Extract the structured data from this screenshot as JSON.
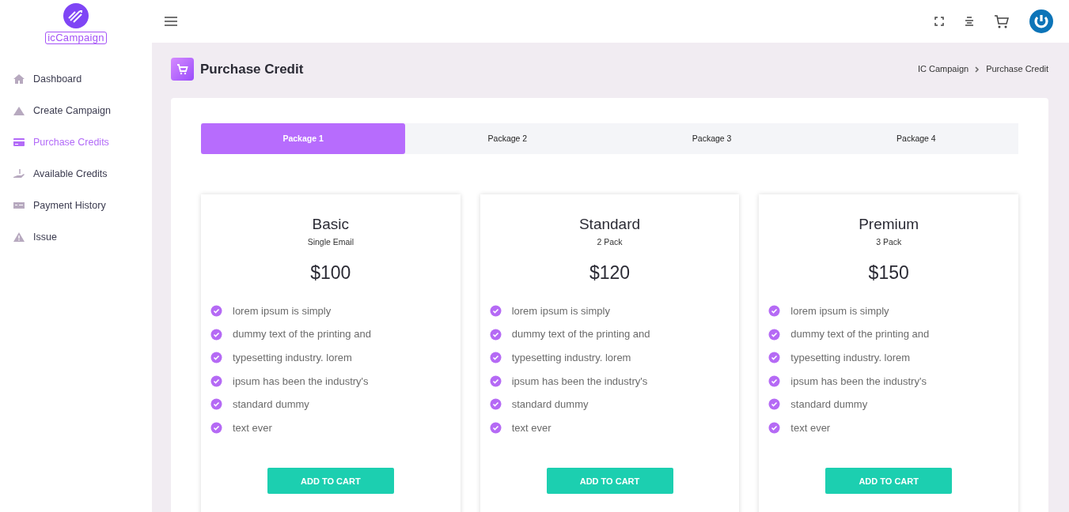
{
  "brand": {
    "name": "icCampaign"
  },
  "sidebar": {
    "items": [
      {
        "label": "Dashboard",
        "selected": false
      },
      {
        "label": "Create Campaign",
        "selected": false
      },
      {
        "label": "Purchase Credits",
        "selected": true
      },
      {
        "label": "Available Credits",
        "selected": false
      },
      {
        "label": "Payment History",
        "selected": false
      },
      {
        "label": "Issue",
        "selected": false
      }
    ]
  },
  "page": {
    "title": "Purchase Credit",
    "breadcrumb": [
      "IC Campaign",
      "Purchase Credit"
    ]
  },
  "tabs": [
    {
      "label": "Package 1",
      "selected": true
    },
    {
      "label": "Package 2",
      "selected": false
    },
    {
      "label": "Package 3",
      "selected": false
    },
    {
      "label": "Package 4",
      "selected": false
    }
  ],
  "plans": [
    {
      "name": "Basic",
      "subtitle": "Single Email",
      "price": "$100",
      "features": [
        "lorem ipsum is simply",
        "dummy text of the printing and",
        "typesetting industry. lorem",
        "ipsum has been the industry's",
        "standard dummy",
        "text ever"
      ],
      "button": "ADD TO CART"
    },
    {
      "name": "Standard",
      "subtitle": "2 Pack",
      "price": "$120",
      "features": [
        "lorem ipsum is simply",
        "dummy text of the printing and",
        "typesetting industry. lorem",
        "ipsum has been the industry's",
        "standard dummy",
        "text ever"
      ],
      "button": "ADD TO CART"
    },
    {
      "name": "Premium",
      "subtitle": "3 Pack",
      "price": "$150",
      "features": [
        "lorem ipsum is simply",
        "dummy text of the printing and",
        "typesetting industry. lorem",
        "ipsum has been the industry's",
        "standard dummy",
        "text ever"
      ],
      "button": "ADD TO CART"
    }
  ]
}
